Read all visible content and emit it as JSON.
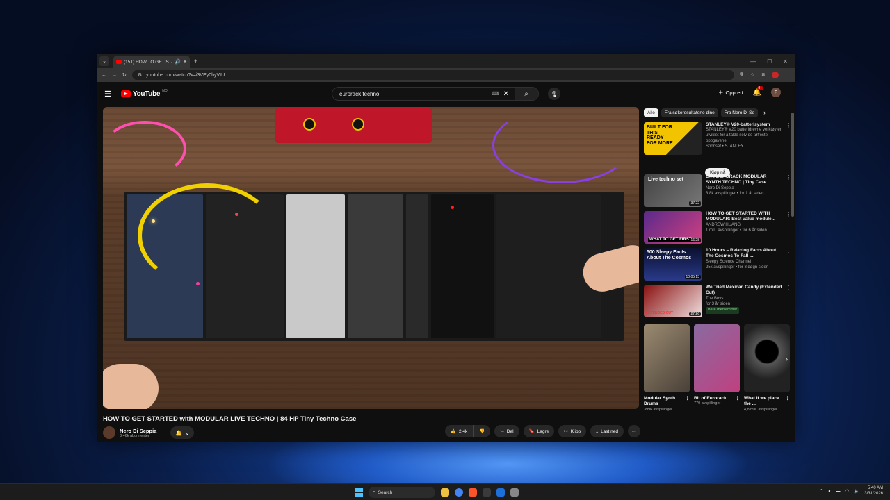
{
  "browser": {
    "tab_title": "(151) HOW TO GET STARTE",
    "tab_audio_icon": "speaker-icon",
    "new_tab": "+",
    "url": "youtube.com/watch?v=i3VEy0hyVtU"
  },
  "youtube": {
    "logo": "YouTube",
    "logo_country": "NO",
    "search_query": "eurorack techno",
    "create_label": "Opprett",
    "notif_count": "9+",
    "avatar_letter": "F"
  },
  "video": {
    "title": "HOW TO GET STARTED with MODULAR LIVE TECHNO | 84 HP Tiny Techno Case",
    "channel": "Nero Di Seppia",
    "subscribers": "3,46k abonnenter",
    "likes": "2,4k",
    "share": "Del",
    "save": "Lagre",
    "clip": "Klipp",
    "download": "Last ned"
  },
  "sidebar": {
    "chips": [
      "Alle",
      "Fra søkeresultatene dine",
      "Fra Nero Di Se"
    ],
    "ad": {
      "title": "STANLEY® V20-batterisystem",
      "desc": "STANLEY® V20 batteridrevne verktøy er utviklet for å takle selv de tøffeste oppgavene.",
      "sponsor": "Sponset • STANLEY",
      "button": "Kjøp nå",
      "thumb_text": "BUILT FOR THIS READY FOR MORE"
    },
    "videos": [
      {
        "title": "Live EURORACK MODULAR SYNTH TECHNO | Tiny Case",
        "channel": "Nero Di Seppia",
        "stats": "3,8k avspillinger • for 1 år siden",
        "duration": "37:22",
        "thumb_text": "Live techno set"
      },
      {
        "title": "HOW TO GET STARTED WITH MODULAR: Best value module...",
        "channel": "ANDREW HUANG",
        "stats": "1 mill. avspillinger • for 6 år siden",
        "duration": "16:28",
        "thumb_text": "WHAT TO GET FIRST"
      },
      {
        "title": "10 Hours – Relaxing Facts About The Cosmos To Fall ...",
        "channel": "Sleepy Science Channel",
        "stats": "25k avspillinger • for 8 døgn siden",
        "duration": "10:05:13",
        "thumb_text": "500 Sleepy Facts About The Cosmos"
      },
      {
        "title": "We Tried Mexican Candy (Extended Cut)",
        "channel": "The Boys",
        "stats": "for 3 år siden",
        "duration": "27:26",
        "badge": "Bare medlemmer",
        "thumb_text": "EXTENDED CUT"
      }
    ],
    "shorts": [
      {
        "title": "Modular Synth Drums",
        "views": "399k avspillinger"
      },
      {
        "title": "Bit of Eurorack ...",
        "views": "770 avspillinger"
      },
      {
        "title": "What if we place the ...",
        "views": "4,8 mill. avspillinger"
      }
    ]
  },
  "taskbar": {
    "search": "Search",
    "time": "5:40 AM",
    "date": "3/31/2026"
  },
  "colors": {
    "yt_red": "#ff0000",
    "bg": "#0f0f0f",
    "chip": "#272727"
  }
}
